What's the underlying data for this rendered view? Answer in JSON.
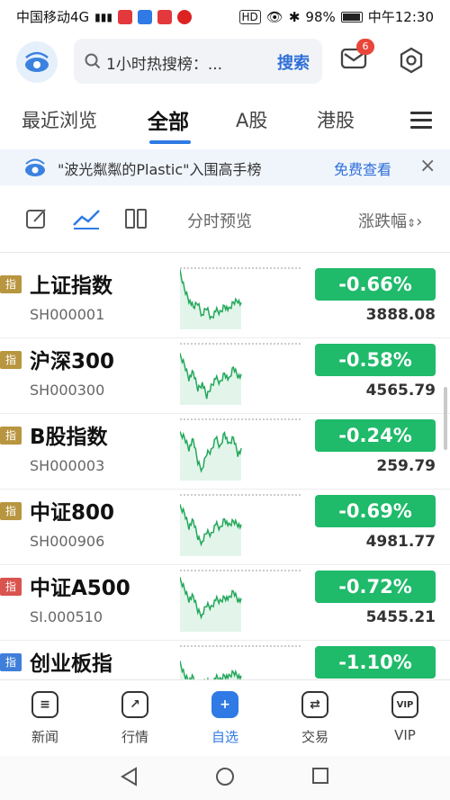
{
  "status_bar": {
    "carrier": "中国移动4G",
    "battery": "98%",
    "time": "中午12:30"
  },
  "header": {
    "search_placeholder": "1小时热搜榜：...",
    "search_button": "搜索",
    "mail_badge": "6"
  },
  "tabs": [
    {
      "label": "最近浏览"
    },
    {
      "label": "全部"
    },
    {
      "label": "A股"
    },
    {
      "label": "港股"
    }
  ],
  "banner": {
    "text": "\"波光粼粼的Plastic\"入围高手榜",
    "cta": "免费查看",
    "close": "×"
  },
  "toolbar": {
    "label": "分时预览",
    "sort_label": "涨跌幅"
  },
  "rows": [
    {
      "tag": "指",
      "name": "上证指数",
      "code": "SH000001",
      "change": "-0.66%",
      "price": "3888.08",
      "tag_color": "#b8953f"
    },
    {
      "tag": "指",
      "name": "沪深300",
      "code": "SH000300",
      "change": "-0.58%",
      "price": "4565.79",
      "tag_color": "#b8953f"
    },
    {
      "tag": "指",
      "name": "B股指数",
      "code": "SH000003",
      "change": "-0.24%",
      "price": "259.79",
      "tag_color": "#b8953f"
    },
    {
      "tag": "指",
      "name": "中证800",
      "code": "SH000906",
      "change": "-0.69%",
      "price": "4981.77",
      "tag_color": "#b8953f"
    },
    {
      "tag": "指",
      "name": "中证A500",
      "code": "SI.000510",
      "change": "-0.72%",
      "price": "5455.21",
      "tag_color": "#d9534f"
    },
    {
      "tag": "指",
      "name": "创业板指",
      "code": "",
      "change": "-1.10%",
      "price": "",
      "tag_color": "#3f7fd9"
    }
  ],
  "bottom_nav": [
    {
      "label": "新闻",
      "icon": "news-icon"
    },
    {
      "label": "行情",
      "icon": "market-icon"
    },
    {
      "label": "自选",
      "icon": "watchlist-icon"
    },
    {
      "label": "交易",
      "icon": "trade-icon"
    },
    {
      "label": "VIP",
      "icon": "vip-icon"
    }
  ],
  "colors": {
    "accent": "#2f7ae5",
    "down": "#1fba6a"
  }
}
